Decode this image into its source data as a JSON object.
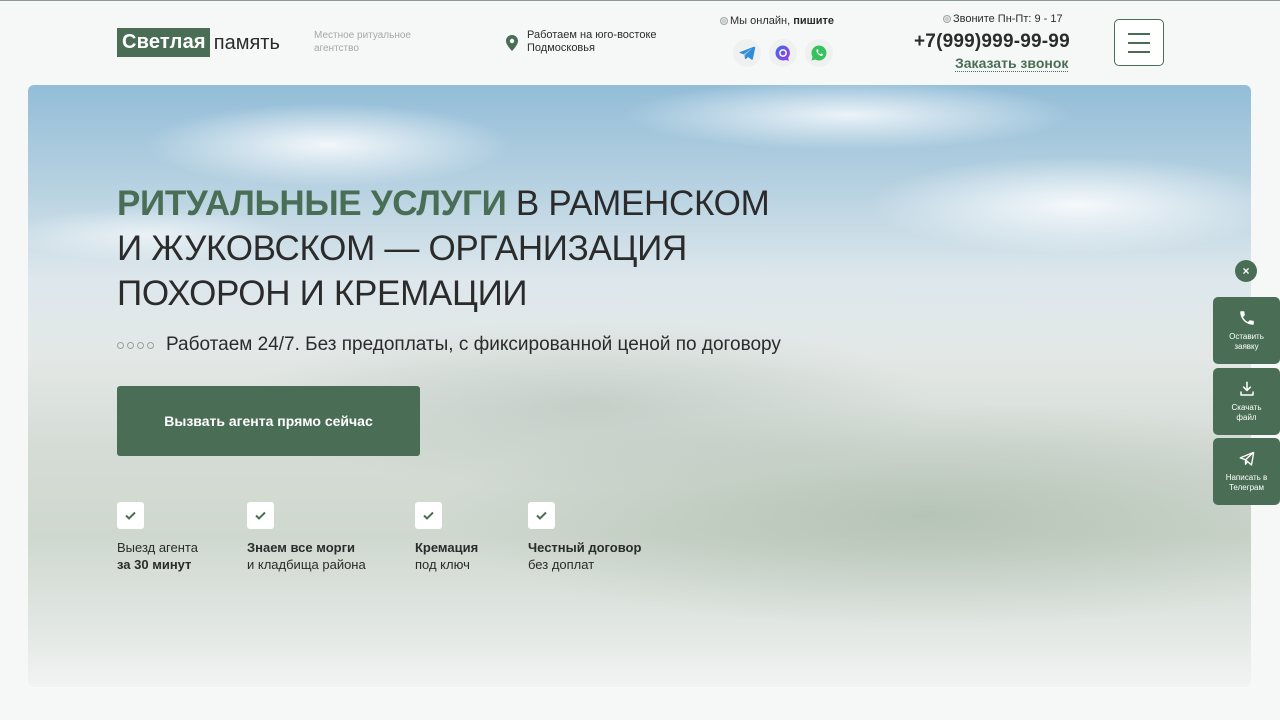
{
  "header": {
    "logo_box": "Светлая",
    "logo_text": "память",
    "tagline": "Местное ритуальное агентство",
    "location": "Работаем на юго-востоке Подмосковья",
    "online_prefix": "Мы онлайн,",
    "online_action": "пишите",
    "messengers": [
      "telegram-icon",
      "max-messenger-icon",
      "whatsapp-icon"
    ],
    "hours": "Звоните Пн-Пт: 9 - 17",
    "phone": "+7(999)999-99-99",
    "callback": "Заказать звонок"
  },
  "hero": {
    "title_accent": "РИТУАЛЬНЫЕ УСЛУГИ",
    "title_line1_rest": " В РАМЕНСКОМ",
    "title_line2": "И ЖУКОВСКОМ — ОРГАНИЗАЦИЯ",
    "title_line3": "ПОХОРОН И КРЕМАЦИИ",
    "subline": "Работаем 24/7. Без предоплаты, с фиксированной ценой по договору",
    "cta": "Вызвать агента прямо сейчас",
    "features": [
      {
        "line1": "Выезд агента",
        "line2": "за 30 минут"
      },
      {
        "line1": "Знаем все морги",
        "line2": "и кладбища района"
      },
      {
        "line1": "Кремация",
        "line2": "под ключ"
      },
      {
        "line1": "Честный договор",
        "line2": "без доплат"
      }
    ]
  },
  "side": {
    "close": "×",
    "buttons": [
      {
        "label1": "Оставить",
        "label2": "заявку",
        "icon": "phone-icon"
      },
      {
        "label1": "Скачать",
        "label2": "файл",
        "icon": "download-icon"
      },
      {
        "label1": "Написать в",
        "label2": "Телеграм",
        "icon": "paper-plane-icon"
      }
    ]
  },
  "colors": {
    "accent": "#4a6e55",
    "text": "#2b2b2b",
    "muted": "#a4a8a6",
    "background": "#f6f8f7"
  }
}
